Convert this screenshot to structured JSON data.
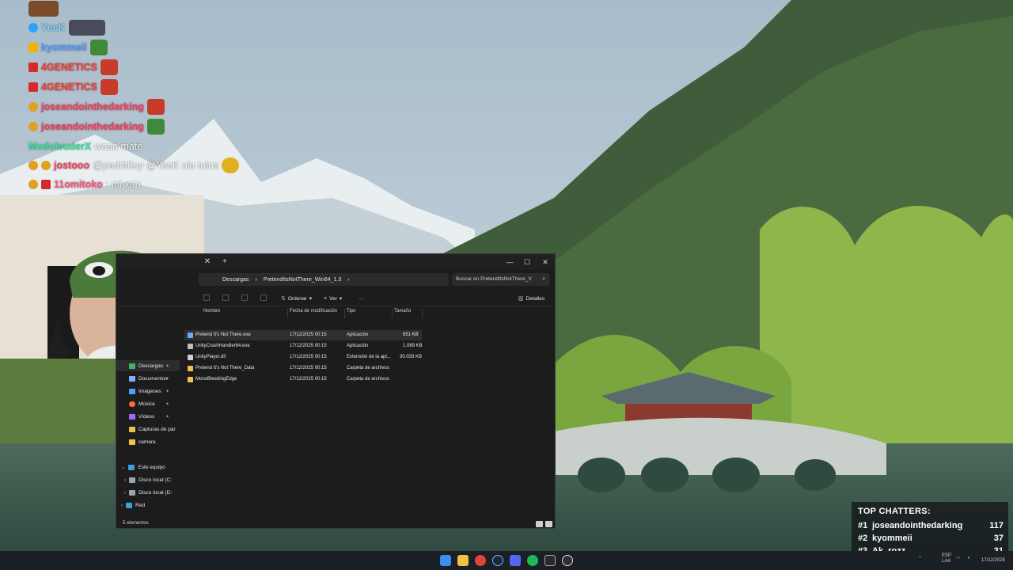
{
  "chat": {
    "messages": [
      {
        "user": "",
        "text": "",
        "user_color": "#f2a23a"
      },
      {
        "user": "YesK",
        "text": "",
        "user_color": "#7fd3ff"
      },
      {
        "user": "kyommeii",
        "text": "",
        "user_color": "#5aa0ff"
      },
      {
        "user": "4GENETICS",
        "text": "",
        "user_color": "#ff3b30"
      },
      {
        "user": "4GENETICS",
        "text": "",
        "user_color": "#ff3b30"
      },
      {
        "user": "joseandointhedarking",
        "text": "",
        "user_color": "#ff3b5c"
      },
      {
        "user": "joseandointhedarking",
        "text": "",
        "user_color": "#ff3b5c"
      },
      {
        "user": "ModoleuderX",
        "text": "waaa mate",
        "user_color": "#3ee0a0"
      },
      {
        "user": "jostooo",
        "text": "@pedrit0uy @YesK ola tuins",
        "user_color": "#ff3b5c"
      },
      {
        "user": "11omitoko",
        "text": ": mi xan",
        "user_color": "#ff5577"
      }
    ]
  },
  "explorer": {
    "breadcrumb": [
      "Descargas",
      "PretendItsNotThere_Win64_1.3"
    ],
    "search_placeholder": "Buscar en PretendItsNotThere_V",
    "toolbar": {
      "sort": "Ordenar",
      "view": "Ver",
      "more": "···",
      "details": "Detalles"
    },
    "columns": {
      "name": "Nombre",
      "date": "Fecha de modificación",
      "type": "Tipo",
      "size": "Tamaño"
    },
    "files": [
      {
        "name": "Pretend It's Not There.exe",
        "date": "17/12/2025 00:15",
        "type": "Aplicación",
        "size": "651 KB",
        "icon_color": "#6fa8ff"
      },
      {
        "name": "UnityCrashHandler64.exe",
        "date": "17/12/2025 00:15",
        "type": "Aplicación",
        "size": "1.089 KB",
        "icon_color": "#bdbdbd"
      },
      {
        "name": "UnityPlayer.dll",
        "date": "17/12/2025 00:15",
        "type": "Extensión de la apl...",
        "size": "30.033 KB",
        "icon_color": "#cfcfcf"
      },
      {
        "name": "Pretend It's Not There_Data",
        "date": "17/12/2025 00:15",
        "type": "Carpeta de archivos",
        "size": "",
        "icon_color": "#f0c24a"
      },
      {
        "name": "MonoBleedingEdge",
        "date": "17/12/2025 00:15",
        "type": "Carpeta de archivos",
        "size": "",
        "icon_color": "#f0c24a"
      }
    ],
    "nav": {
      "quick": [
        {
          "label": "Descargas",
          "icon_color": "#3fb36b"
        },
        {
          "label": "Documentos",
          "icon_color": "#7fb0ff"
        },
        {
          "label": "Imágenes",
          "icon_color": "#4aa3ff"
        },
        {
          "label": "Música",
          "icon_color": "#ff6a3d"
        },
        {
          "label": "Vídeos",
          "icon_color": "#9b6bff"
        },
        {
          "label": "Capturas de par",
          "icon_color": "#f0c24a"
        },
        {
          "label": "camara",
          "icon_color": "#f0c24a"
        }
      ],
      "this_pc": "Este equipo",
      "drives": [
        "Disco local (C:",
        "Disco local (D:"
      ],
      "network": "Red"
    },
    "status": "5 elementos"
  },
  "top_chatters": {
    "title": "TOP CHATTERS:",
    "entries": [
      {
        "rank": "#1",
        "name": "joseandointhedarking",
        "count": "117"
      },
      {
        "rank": "#2",
        "name": "kyommeii",
        "count": "37"
      },
      {
        "rank": "#3",
        "name": "Ak_rozz",
        "count": "31"
      }
    ]
  },
  "taskbar": {
    "lang": "ESP",
    "lang2": "LAA",
    "date": "17/12/2025",
    "apps": [
      "start-icon",
      "file-explorer-icon",
      "chrome-icon",
      "steam-icon",
      "discord-icon",
      "spotify-icon",
      "epic-games-icon",
      "obs-icon"
    ]
  }
}
